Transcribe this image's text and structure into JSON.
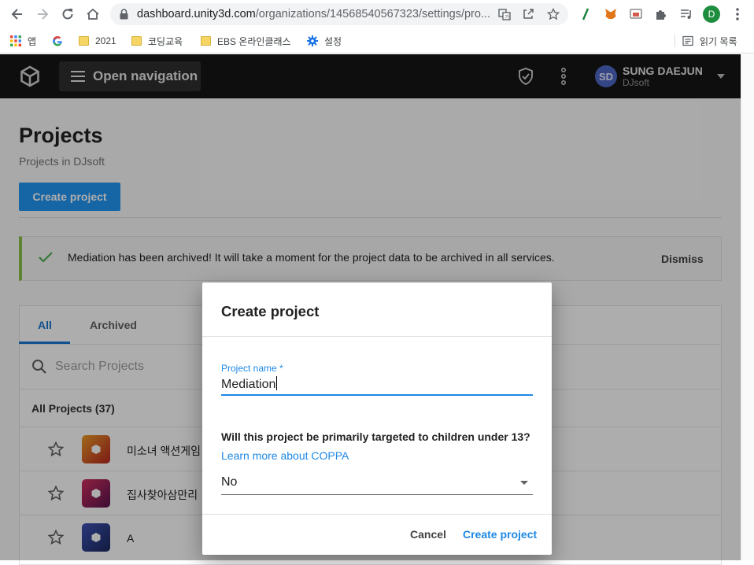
{
  "browser": {
    "url_host": "dashboard.unity3d.com",
    "url_path": "/organizations/14568540567323/settings/pro...",
    "profile_initial": "D",
    "bookmarks": [
      {
        "label": "앱",
        "icon": "apps-grid-icon"
      },
      {
        "label": "",
        "icon": "google-icon"
      },
      {
        "label": "2021",
        "icon": "folder-icon"
      },
      {
        "label": "코딩교육",
        "icon": "folder-icon"
      },
      {
        "label": "EBS 온라인클래스",
        "icon": "folder-icon"
      },
      {
        "label": "설정",
        "icon": "gear-icon"
      }
    ],
    "reading_list": "읽기 목록"
  },
  "header": {
    "nav_label": "Open navigation",
    "user_initials": "SD",
    "user_name": "SUNG DAEJUN",
    "user_org": "DJsoft"
  },
  "page": {
    "title": "Projects",
    "subtitle": "Projects in DJsoft",
    "create_button": "Create project",
    "alert_text": "Mediation has been archived! It will take a moment for the project data to be archived in all services.",
    "alert_dismiss": "Dismiss",
    "tabs": [
      "All",
      "Archived"
    ],
    "search_placeholder": "Search Projects",
    "all_projects_label": "All Projects (37)",
    "projects": [
      {
        "name": "미소녀 액션게임",
        "color": "#d97a1c"
      },
      {
        "name": "집사찾아삼만리",
        "color": "#b5245e"
      },
      {
        "name": "A",
        "color": "#2f3f8f"
      }
    ]
  },
  "dialog": {
    "title": "Create project",
    "field_label": "Project name *",
    "field_value": "Mediation",
    "question": "Will this project be primarily targeted to children under 13?",
    "coppa_link": "Learn more about COPPA",
    "select_value": "No",
    "cancel": "Cancel",
    "confirm": "Create project"
  },
  "colors": {
    "accent": "#2196f3",
    "link": "#1e88e5",
    "header_bg": "#151515",
    "success": "#8bc34a"
  }
}
